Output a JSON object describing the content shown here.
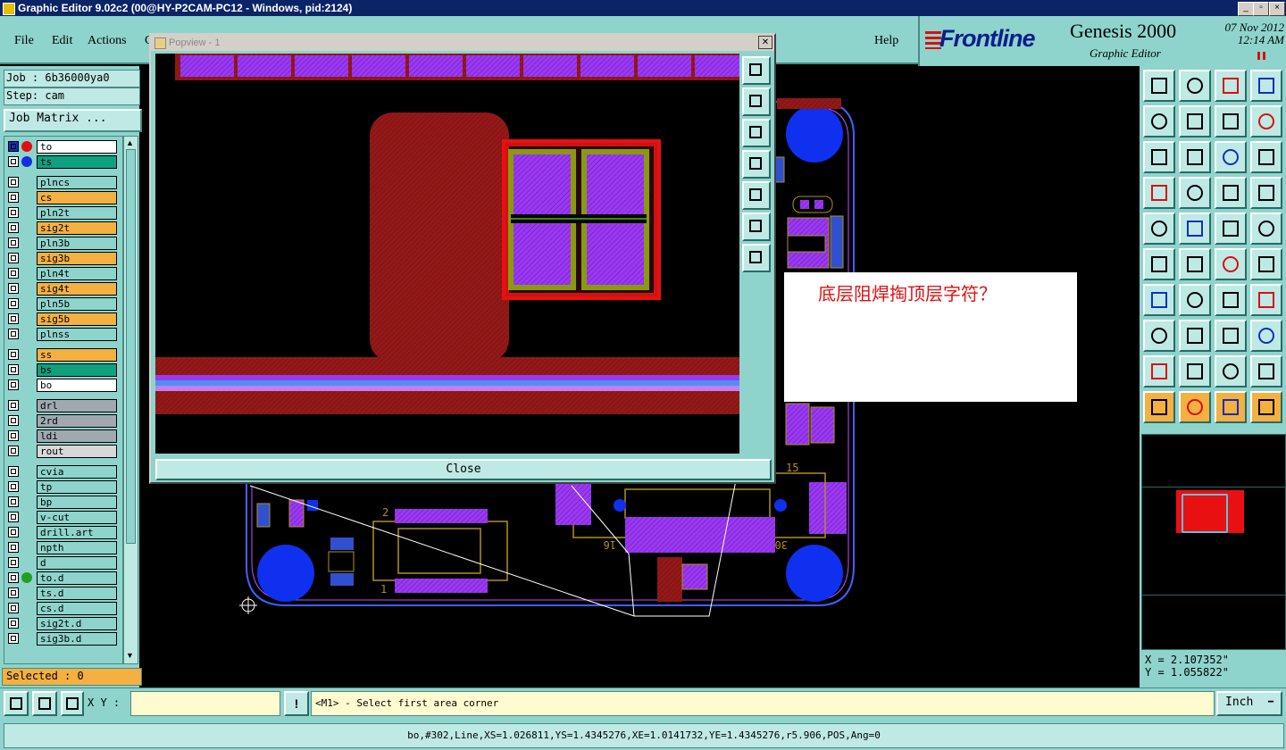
{
  "window": {
    "title": "Graphic Editor 9.02c2 (00@HY-P2CAM-PC12 - Windows, pid:2124)"
  },
  "menu": {
    "file": "File",
    "edit": "Edit",
    "actions": "Actions",
    "partial": "C",
    "help": "Help"
  },
  "brand": {
    "logo": "Frontline",
    "product": "Genesis 2000",
    "subtitle": "Graphic Editor",
    "date": "07 Nov 2012",
    "time": "12:14 AM"
  },
  "job": {
    "job_label": "Job : 6b36000ya0",
    "step_label": "Step: cam",
    "matrix_button": "Job Matrix ..."
  },
  "layers": [
    {
      "name": "to",
      "color": "#ffffff",
      "dot": "#e01010",
      "sel": true
    },
    {
      "name": "ts",
      "color": "#10a080",
      "dot": "#1030e0",
      "sel": false
    },
    {
      "name": "plncs",
      "color": "#8ed4cc",
      "dot": "",
      "sel": false
    },
    {
      "name": "cs",
      "color": "#f4b040",
      "dot": "",
      "sel": false
    },
    {
      "name": "pln2t",
      "color": "#8ed4cc",
      "dot": "",
      "sel": false
    },
    {
      "name": "sig2t",
      "color": "#f4b040",
      "dot": "",
      "sel": false
    },
    {
      "name": "pln3b",
      "color": "#8ed4cc",
      "dot": "",
      "sel": false
    },
    {
      "name": "sig3b",
      "color": "#f4b040",
      "dot": "",
      "sel": false
    },
    {
      "name": "pln4t",
      "color": "#8ed4cc",
      "dot": "",
      "sel": false
    },
    {
      "name": "sig4t",
      "color": "#f4b040",
      "dot": "",
      "sel": false
    },
    {
      "name": "pln5b",
      "color": "#8ed4cc",
      "dot": "",
      "sel": false
    },
    {
      "name": "sig5b",
      "color": "#f4b040",
      "dot": "",
      "sel": false
    },
    {
      "name": "plnss",
      "color": "#8ed4cc",
      "dot": "",
      "sel": false
    },
    {
      "name": "ss",
      "color": "#f4b040",
      "dot": "",
      "sel": false
    },
    {
      "name": "bs",
      "color": "#10a080",
      "dot": "",
      "sel": false
    },
    {
      "name": "bo",
      "color": "#ffffff",
      "dot": "",
      "sel": false
    },
    {
      "name": "drl",
      "color": "#a0a8b0",
      "dot": "",
      "sel": false
    },
    {
      "name": "2rd",
      "color": "#a0a8b0",
      "dot": "",
      "sel": false
    },
    {
      "name": "ldi",
      "color": "#a0a8b0",
      "dot": "",
      "sel": false
    },
    {
      "name": "rout",
      "color": "#d8d8d8",
      "dot": "",
      "sel": false
    },
    {
      "name": "cvia",
      "color": "#8ed4cc",
      "dot": "",
      "sel": false
    },
    {
      "name": "tp",
      "color": "#8ed4cc",
      "dot": "",
      "sel": false
    },
    {
      "name": "bp",
      "color": "#8ed4cc",
      "dot": "",
      "sel": false
    },
    {
      "name": "v-cut",
      "color": "#8ed4cc",
      "dot": "",
      "sel": false
    },
    {
      "name": "drill.art",
      "color": "#8ed4cc",
      "dot": "",
      "sel": false
    },
    {
      "name": "npth",
      "color": "#8ed4cc",
      "dot": "",
      "sel": false
    },
    {
      "name": "d",
      "color": "#8ed4cc",
      "dot": "",
      "sel": false
    },
    {
      "name": "to.d",
      "color": "#8ed4cc",
      "dot": "#20a020",
      "sel": false
    },
    {
      "name": "ts.d",
      "color": "#8ed4cc",
      "dot": "",
      "sel": false
    },
    {
      "name": "cs.d",
      "color": "#8ed4cc",
      "dot": "",
      "sel": false
    },
    {
      "name": "sig2t.d",
      "color": "#8ed4cc",
      "dot": "",
      "sel": false
    },
    {
      "name": "sig3b.d",
      "color": "#8ed4cc",
      "dot": "",
      "sel": false
    }
  ],
  "selected_label": "Selected : 0",
  "popview": {
    "title": "Popview - 1",
    "close_button": "Close",
    "close_glyph": "✕"
  },
  "note": {
    "text": "底层阻焊掏顶层字符？"
  },
  "coords": {
    "x": "X = 2.107352\"",
    "y": "Y = 1.055822\""
  },
  "board": {
    "label_2": "2",
    "label_1": "1",
    "label_15": "15",
    "label_16": "16",
    "label_30": "30"
  },
  "bottom": {
    "xy_label": "X Y :",
    "xy_input_value": "",
    "prompt": "<M1> - Select first area corner",
    "units": "Inch",
    "units_glyph": "━",
    "status_line": "bo,#302,Line,XS=1.026811,YS=1.4345276,XE=1.0141732,YE=1.4345276,r5.906,POS,Ang=0"
  },
  "colors": {
    "panel": "#8ed4cc",
    "board_pad": "#9a3af0",
    "copper": "#8a1616",
    "mask_red": "#e81010",
    "outline": "#b09020"
  }
}
